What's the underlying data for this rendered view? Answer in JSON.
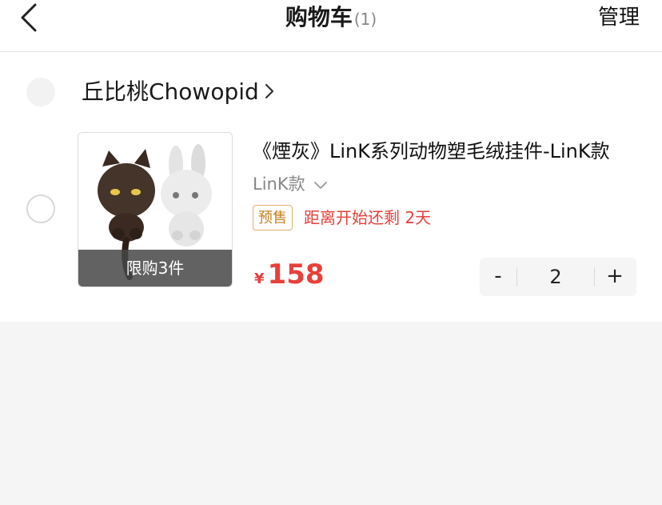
{
  "header": {
    "title": "购物车",
    "count": "(1)",
    "manage_label": "管理"
  },
  "store": {
    "name": "丘比桃Chowopid"
  },
  "item": {
    "title": "《煙灰》LinK系列动物塑毛绒挂件-LinK款",
    "variant": "LinK款",
    "presale_tag": "预售",
    "countdown": "距离开始还剩 2天",
    "limit": "限购3件",
    "price_symbol": "¥",
    "price": "158",
    "quantity": "2",
    "minus_label": "-",
    "plus_label": "+"
  },
  "colors": {
    "accent_red": "#e8403a",
    "presale_orange": "#c8801f"
  }
}
